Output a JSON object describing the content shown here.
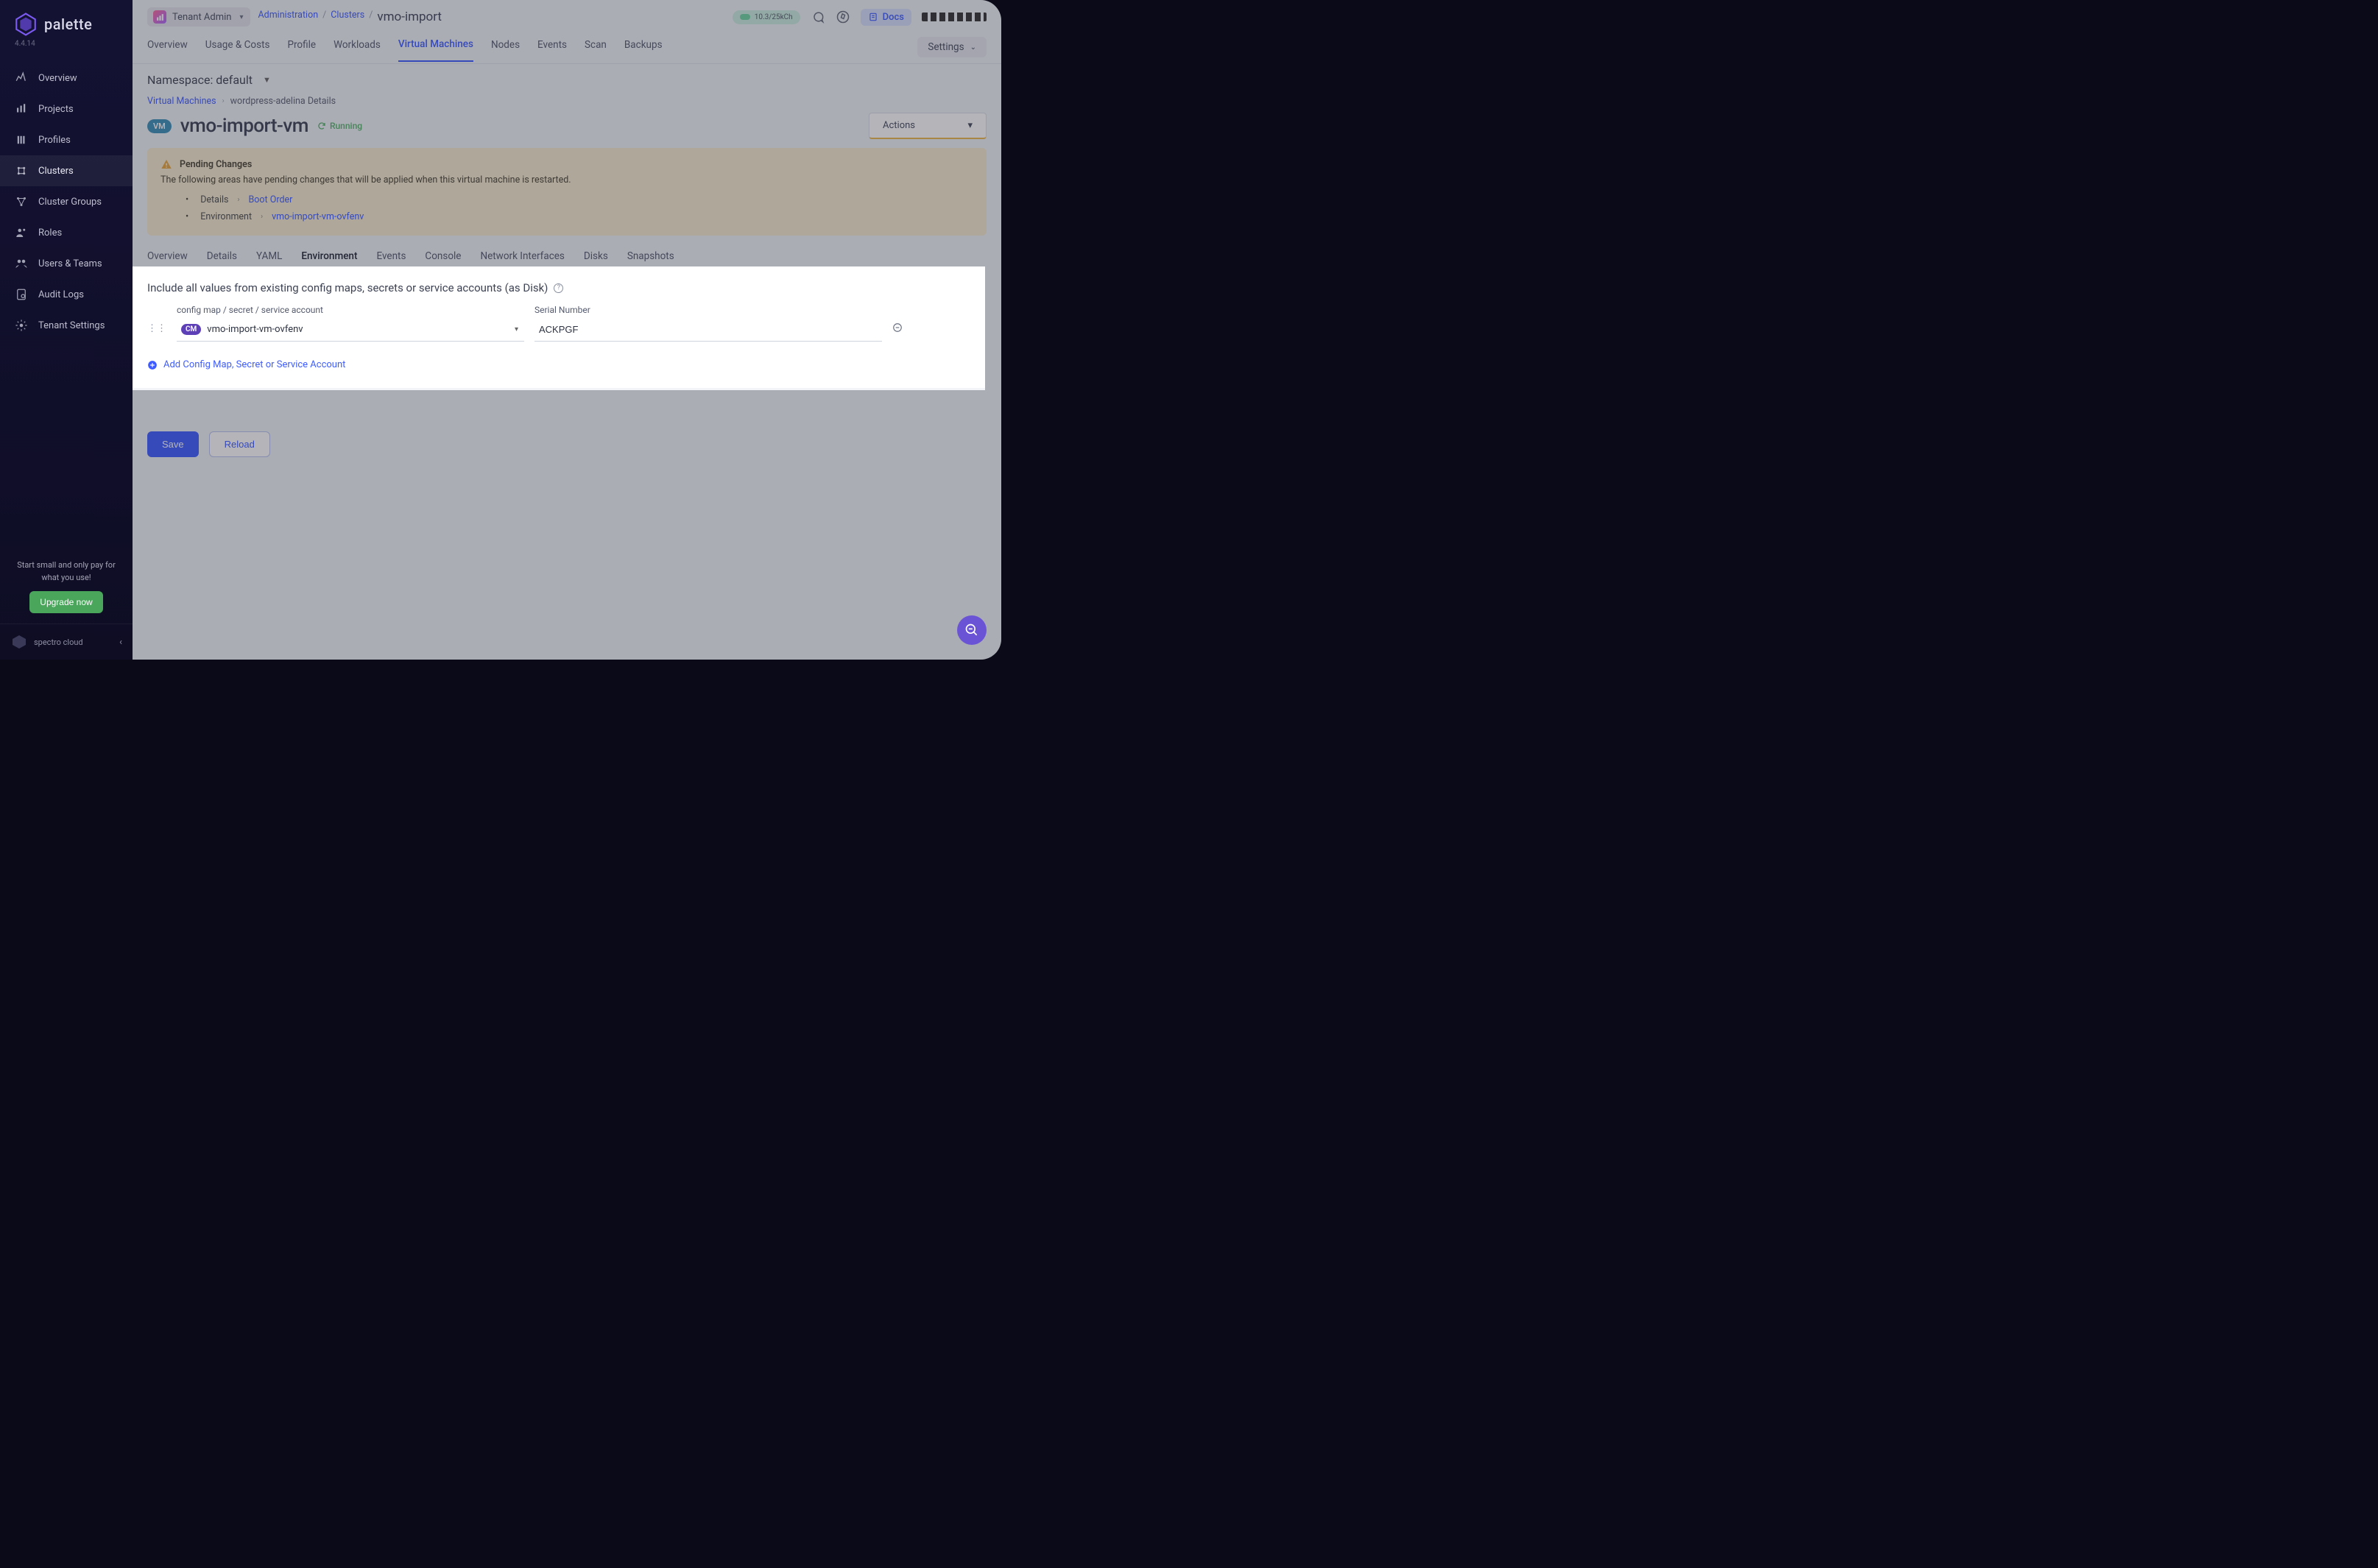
{
  "brand": {
    "name": "palette",
    "version": "4.4.14",
    "footer": "spectro cloud"
  },
  "sidebar": {
    "items": [
      {
        "label": "Overview",
        "icon": "overview"
      },
      {
        "label": "Projects",
        "icon": "projects"
      },
      {
        "label": "Profiles",
        "icon": "profiles"
      },
      {
        "label": "Clusters",
        "icon": "clusters",
        "active": true
      },
      {
        "label": "Cluster Groups",
        "icon": "cluster-groups"
      },
      {
        "label": "Roles",
        "icon": "roles"
      },
      {
        "label": "Users & Teams",
        "icon": "users-teams"
      },
      {
        "label": "Audit Logs",
        "icon": "audit-logs"
      },
      {
        "label": "Tenant Settings",
        "icon": "tenant-settings"
      }
    ],
    "upgrade_text": "Start small and only pay for what you use!",
    "upgrade_button": "Upgrade now"
  },
  "topbar": {
    "tenant": "Tenant Admin",
    "crumb1": "Administration",
    "crumb2": "Clusters",
    "crumb3": "vmo-import",
    "usage": "10.3/25kCh",
    "docs": "Docs"
  },
  "tabs1": {
    "items": [
      "Overview",
      "Usage & Costs",
      "Profile",
      "Workloads",
      "Virtual Machines",
      "Nodes",
      "Events",
      "Scan",
      "Backups"
    ],
    "active_index": 4,
    "settings": "Settings"
  },
  "namespace_row": "Namespace: default",
  "breadcrumb2": {
    "link": "Virtual Machines",
    "current": "wordpress-adelina Details"
  },
  "title": {
    "badge": "VM",
    "name": "vmo-import-vm",
    "status": "Running",
    "actions": "Actions"
  },
  "pending": {
    "heading": "Pending Changes",
    "desc": "The following areas have pending changes that will be applied when this virtual machine is restarted.",
    "items": [
      {
        "label": "Details",
        "link": "Boot Order"
      },
      {
        "label": "Environment",
        "link": "vmo-import-vm-ovfenv"
      }
    ]
  },
  "tabs2": {
    "items": [
      "Overview",
      "Details",
      "YAML",
      "Environment",
      "Events",
      "Console",
      "Network Interfaces",
      "Disks",
      "Snapshots"
    ],
    "active_index": 3
  },
  "section": {
    "title": "Include all values from existing config maps, secrets or service accounts (as Disk)",
    "field1_label": "config map / secret / service account",
    "field2_label": "Serial Number",
    "select_badge": "CM",
    "select_value": "vmo-import-vm-ovfenv",
    "serial_value": "ACKPGF",
    "add_link": "Add Config Map, Secret or Service Account"
  },
  "buttons": {
    "save": "Save",
    "reload": "Reload"
  }
}
